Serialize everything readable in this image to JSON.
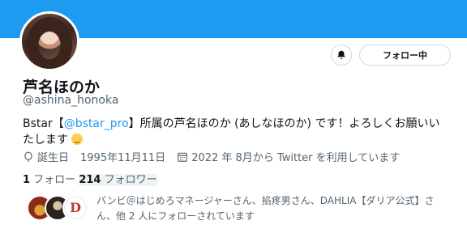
{
  "profile": {
    "name": "芦名ほのか",
    "handle": "@ashina_honoka",
    "bio_prefix": "Bstar【",
    "bio_link": "@bstar_pro",
    "bio_suffix": "】所属の芦名ほのか (あしなほのか) です！よろしくお願いいたします",
    "birthday_label": "誕生日",
    "birthday": "1995年11月11日",
    "joined": "2022 年 8月から Twitter を利用しています"
  },
  "actions": {
    "follow_label": "フォロー中"
  },
  "stats": {
    "following_count": "1",
    "following_label": " フォロー ",
    "followers_count": "214",
    "followers_label": " フォロワー"
  },
  "followed_by": {
    "text": "バンビ＠はじめろマネージャーさん、掐疼男さん、DAHLIA【ダリア公式】さん、他 2 人にフォローされています",
    "badge_letter": "D"
  },
  "colors": {
    "banner": "#1d9bf0",
    "link": "#1d9bf0"
  }
}
